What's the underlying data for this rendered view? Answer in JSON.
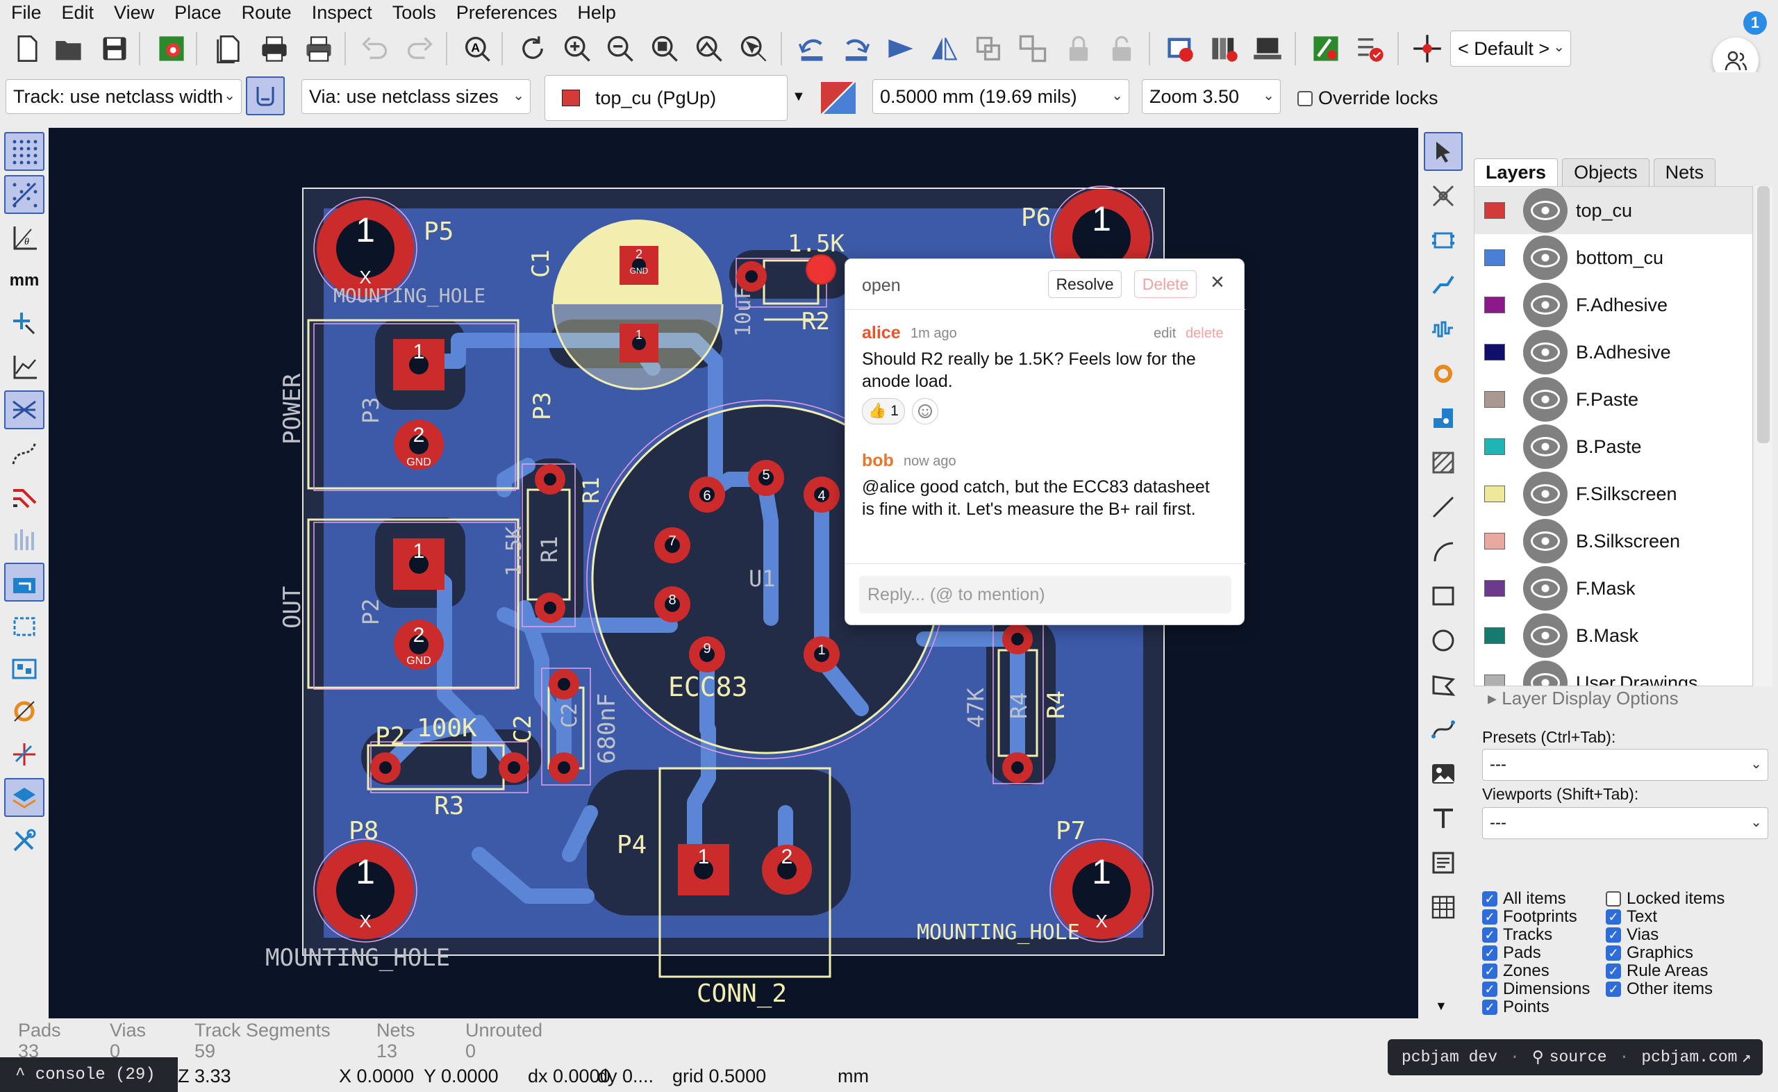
{
  "menu": [
    "File",
    "Edit",
    "View",
    "Place",
    "Route",
    "Inspect",
    "Tools",
    "Preferences",
    "Help"
  ],
  "toolbar": {
    "preset": "< Default >",
    "badge": "1"
  },
  "toolbar2": {
    "track": "Track: use netclass width",
    "via": "Via: use netclass sizes",
    "layer": "top_cu (PgUp)",
    "grid": "0.5000 mm (19.69 mils)",
    "zoom": "Zoom 3.50",
    "override": "Override locks"
  },
  "colors": {
    "board": "#3d5aa8",
    "track": "#5b86d6",
    "pad": "#cc2b2b",
    "silk": "#f2eeb0",
    "courtyard": "#e8a0e8",
    "edge": "#e6e6d8"
  },
  "canvas": {
    "refs": [
      "P5",
      "P6",
      "P3",
      "P2",
      "P4",
      "P8",
      "P7",
      "C1",
      "R1",
      "R2",
      "R3",
      "R4",
      "C2",
      "U1",
      "ECC83"
    ],
    "values": [
      "1.5K",
      "100K",
      "47K",
      "680nF",
      "1.5K",
      "10uF",
      "POWER",
      "OUT",
      "MOUNTING_HOLE",
      "MOUNTING_HOLE",
      "MOUNTING_HOLE",
      "CONN_2",
      "U1"
    ],
    "pad_labels": [
      "1",
      "2",
      "3",
      "4",
      "5",
      "6",
      "7",
      "8",
      "9",
      "GND",
      "X"
    ]
  },
  "comment": {
    "status": "open",
    "resolve": "Resolve",
    "delete": "Delete",
    "close": "×",
    "c1": {
      "author": "alice",
      "time": "1m ago",
      "edit": "edit",
      "del": "delete",
      "text1": "Should R2 really be 1.5K? Feels low for the",
      "text2": "anode load.",
      "reaction": "👍 1"
    },
    "c2": {
      "author": "bob",
      "time": "now ago",
      "text1": "@alice good catch, but the ECC83 datasheet",
      "text2": "is fine with it. Let's measure the B+ rail first."
    },
    "reply_placeholder": "Reply... (@ to mention)"
  },
  "panel": {
    "tabs": [
      "Layers",
      "Objects",
      "Nets"
    ],
    "layers": [
      {
        "name": "top_cu",
        "color": "#d33a3a"
      },
      {
        "name": "bottom_cu",
        "color": "#4a7fd6"
      },
      {
        "name": "F.Adhesive",
        "color": "#8a1a8a"
      },
      {
        "name": "B.Adhesive",
        "color": "#10106a"
      },
      {
        "name": "F.Paste",
        "color": "#a89890"
      },
      {
        "name": "B.Paste",
        "color": "#1fb5b5"
      },
      {
        "name": "F.Silkscreen",
        "color": "#ede89a"
      },
      {
        "name": "B.Silkscreen",
        "color": "#e8a8a0"
      },
      {
        "name": "F.Mask",
        "color": "#6b3a8a"
      },
      {
        "name": "B.Mask",
        "color": "#167a6e"
      },
      {
        "name": "User.Drawings",
        "color": "#b0b0b0"
      }
    ],
    "layer_display_options": "Layer Display Options",
    "presets_label": "Presets (Ctrl+Tab):",
    "presets_value": "---",
    "viewports_label": "Viewports (Shift+Tab):",
    "viewports_value": "---",
    "items_left": [
      {
        "label": "All items",
        "checked": true
      },
      {
        "label": "Footprints",
        "checked": true
      },
      {
        "label": "Tracks",
        "checked": true
      },
      {
        "label": "Pads",
        "checked": true
      },
      {
        "label": "Zones",
        "checked": true
      },
      {
        "label": "Dimensions",
        "checked": true
      },
      {
        "label": "Points",
        "checked": true
      }
    ],
    "items_right": [
      {
        "label": "Locked items",
        "checked": false
      },
      {
        "label": "Text",
        "checked": true
      },
      {
        "label": "Vias",
        "checked": true
      },
      {
        "label": "Graphics",
        "checked": true
      },
      {
        "label": "Rule Areas",
        "checked": true
      },
      {
        "label": "Other items",
        "checked": true
      }
    ]
  },
  "status": {
    "pads_label": "Pads",
    "pads": "33",
    "vias_label": "Vias",
    "vias": "0",
    "tracks_label": "Track Segments",
    "tracks": "59",
    "nets_label": "Nets",
    "nets": "13",
    "unrouted_label": "Unrouted",
    "unrouted": "0",
    "console": "^ console (29)",
    "z": "Z 3.33",
    "x": "X 0.0000",
    "y": "Y 0.0000",
    "dx": "dx 0.0000",
    "dy": "dy 0....",
    "grid": "grid 0.5000",
    "units": "mm",
    "footer1": "pcbjam dev",
    "footer2": "source",
    "footer3": "pcbjam.com"
  }
}
